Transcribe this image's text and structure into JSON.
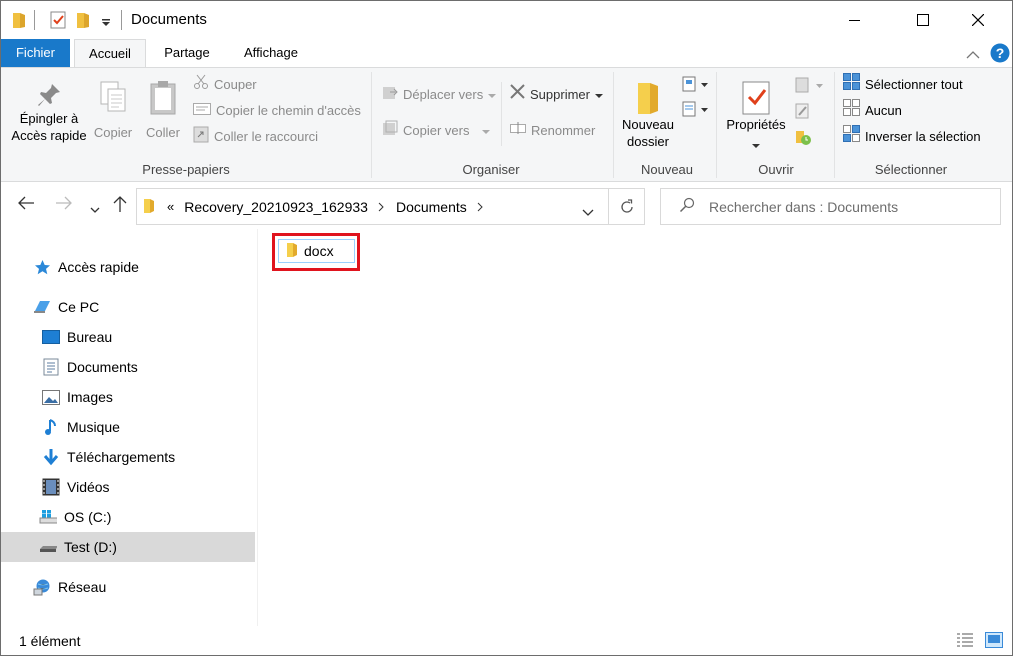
{
  "window": {
    "title": "Documents"
  },
  "ribbon_tabs": {
    "file": "Fichier",
    "home": "Accueil",
    "share": "Partage",
    "view": "Affichage"
  },
  "clipboard": {
    "pin_line1": "Épingler à",
    "pin_line2": "Accès rapide",
    "copy": "Copier",
    "paste": "Coller",
    "cut": "Couper",
    "copy_path": "Copier le chemin d'accès",
    "paste_shortcut": "Coller le raccourci",
    "group": "Presse-papiers"
  },
  "organize": {
    "move_to": "Déplacer vers",
    "copy_to": "Copier vers",
    "delete": "Supprimer",
    "rename": "Renommer",
    "group": "Organiser"
  },
  "new": {
    "new_folder_line1": "Nouveau",
    "new_folder_line2": "dossier",
    "group": "Nouveau"
  },
  "open": {
    "properties": "Propriétés",
    "group": "Ouvrir"
  },
  "select": {
    "select_all": "Sélectionner tout",
    "select_none": "Aucun",
    "invert": "Inverser la sélection",
    "group": "Sélectionner"
  },
  "address": {
    "overflow": "«",
    "crumb1": "Recovery_20210923_162933",
    "crumb2": "Documents"
  },
  "search": {
    "placeholder": "Rechercher dans : Documents"
  },
  "sidebar": {
    "quick_access": "Accès rapide",
    "this_pc": "Ce PC",
    "desktop": "Bureau",
    "documents": "Documents",
    "images": "Images",
    "music": "Musique",
    "downloads": "Téléchargements",
    "videos": "Vidéos",
    "os_drive": "OS (C:)",
    "test_drive": "Test (D:)",
    "network": "Réseau"
  },
  "content": {
    "items": [
      {
        "name": "docx",
        "icon": "folder-icon"
      }
    ]
  },
  "status": {
    "count": "1 élément"
  },
  "colors": {
    "file_tab": "#1979ca",
    "ribbon_bg": "#f5f6f7",
    "selected_nav": "#d9d9d9",
    "highlight_box": "#e0141e",
    "folder": "#f2c94c"
  }
}
